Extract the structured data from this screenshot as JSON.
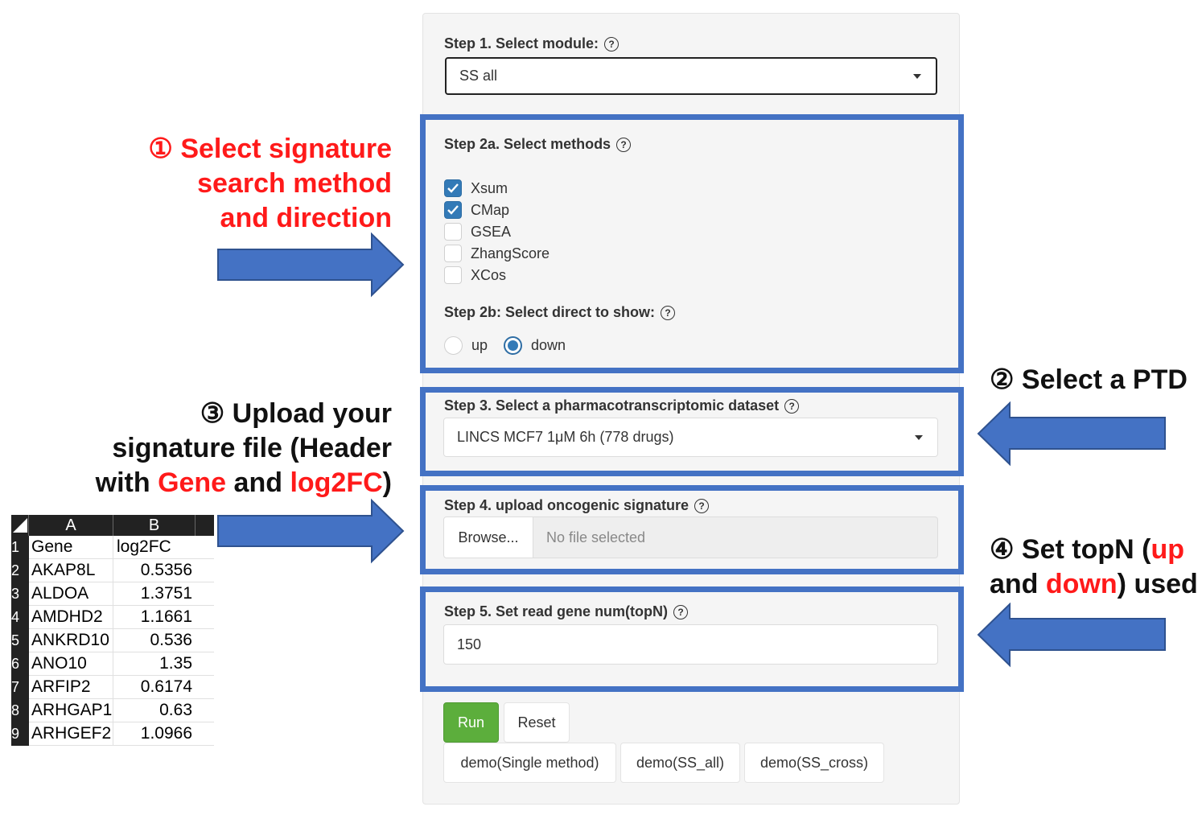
{
  "panel": {
    "step1": {
      "label": "Step 1. Select module:",
      "value": "SS all"
    },
    "step2a": {
      "label": "Step 2a. Select methods",
      "methods": [
        {
          "name": "Xsum",
          "checked": true
        },
        {
          "name": "CMap",
          "checked": true
        },
        {
          "name": "GSEA",
          "checked": false
        },
        {
          "name": "ZhangScore",
          "checked": false
        },
        {
          "name": "XCos",
          "checked": false
        }
      ]
    },
    "step2b": {
      "label": "Step 2b: Select direct to show:",
      "options": [
        {
          "name": "up",
          "checked": false
        },
        {
          "name": "down",
          "checked": true
        }
      ]
    },
    "step3": {
      "label": "Step 3. Select a pharmacotranscriptomic dataset",
      "value": "LINCS MCF7 1μM 6h (778 drugs)"
    },
    "step4": {
      "label": "Step 4. upload oncogenic signature",
      "browse": "Browse...",
      "file": "No file selected"
    },
    "step5": {
      "label": "Step 5. Set read gene num(topN)",
      "value": "150"
    },
    "buttons": {
      "run": "Run",
      "reset": "Reset",
      "demo_single": "demo(Single method)",
      "demo_ss_all": "demo(SS_all)",
      "demo_ss_cross": "demo(SS_cross)"
    },
    "help_glyph": "?"
  },
  "annotations": {
    "a1": {
      "line1": "① Select signature",
      "line2": "search method",
      "line3": "and direction"
    },
    "a2": {
      "text": "② Select a PTD"
    },
    "a3": {
      "line1": "③ Upload your",
      "line2": "signature file (Header",
      "line3_pre": "with ",
      "line3_gene": "Gene",
      "line3_mid": " and ",
      "line3_log": "log2FC",
      "line3_post": ")"
    },
    "a4": {
      "line1_pre": "④ Set topN (",
      "line1_up": "up",
      "line2_pre": "and ",
      "line2_down": "down",
      "line2_post": ") used"
    }
  },
  "spreadsheet": {
    "columns": [
      "A",
      "B"
    ],
    "rows": [
      {
        "num": "1",
        "a": "Gene",
        "b": "log2FC"
      },
      {
        "num": "2",
        "a": "AKAP8L",
        "b": "0.5356"
      },
      {
        "num": "3",
        "a": "ALDOA",
        "b": "1.3751"
      },
      {
        "num": "4",
        "a": "AMDHD2",
        "b": "1.1661"
      },
      {
        "num": "5",
        "a": "ANKRD10",
        "b": "0.536"
      },
      {
        "num": "6",
        "a": "ANO10",
        "b": "1.35"
      },
      {
        "num": "7",
        "a": "ARFIP2",
        "b": "0.6174"
      },
      {
        "num": "8",
        "a": "ARHGAP1",
        "b": "0.63"
      },
      {
        "num": "9",
        "a": "ARHGEF2",
        "b": "1.0966"
      }
    ]
  },
  "colors": {
    "frame": "#4472c4",
    "arrow": "#4472c4",
    "highlight": "#ff1a1a",
    "run": "#5cae3c"
  },
  "icons": [
    "help-icon",
    "caret-down-icon",
    "check-icon",
    "arrow-right-icon",
    "arrow-left-icon"
  ]
}
